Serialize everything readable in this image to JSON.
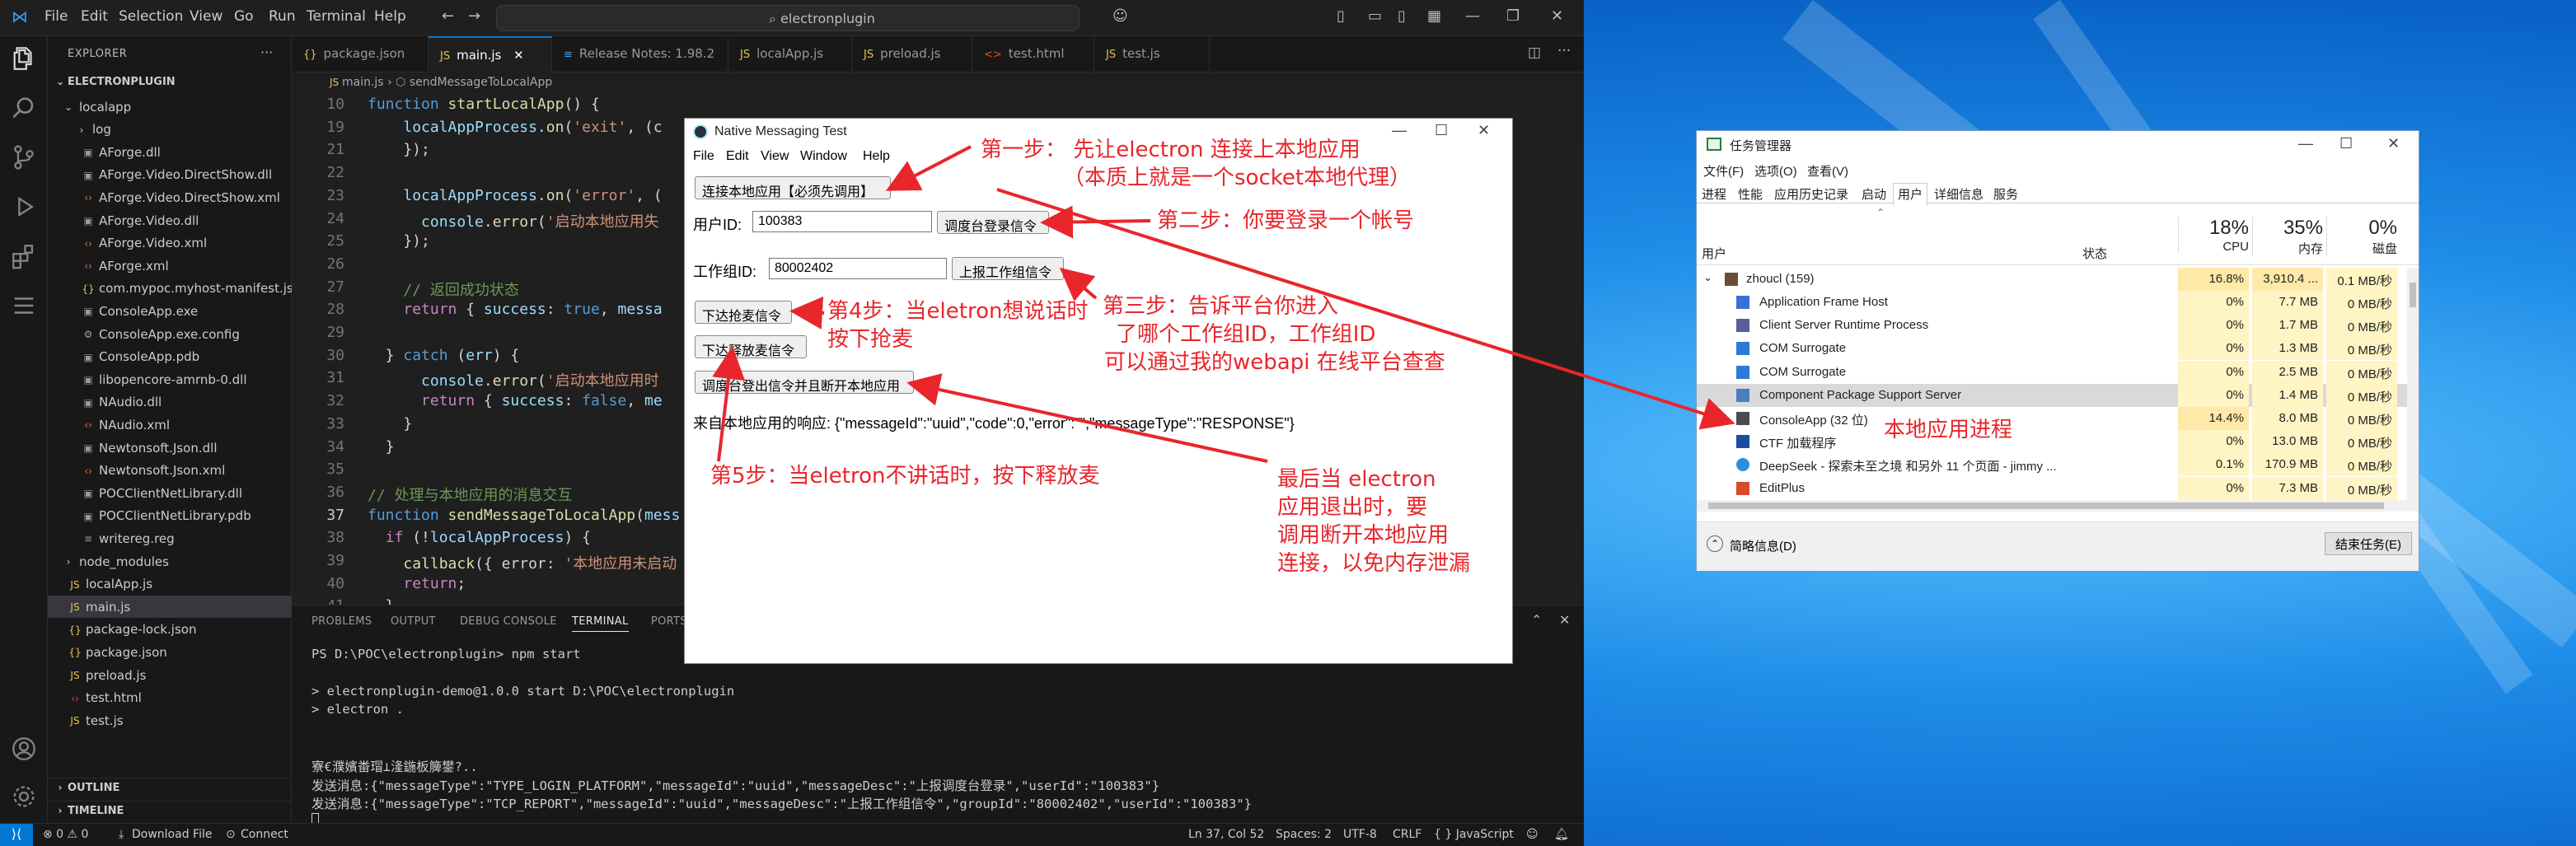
{
  "vscode": {
    "menu": [
      "File",
      "Edit",
      "Selection",
      "View",
      "Go",
      "Run",
      "Terminal",
      "Help"
    ],
    "search": "electronplugin",
    "explorer_title": "EXPLORER",
    "project": "ELECTRONPLUGIN",
    "tree": [
      {
        "name": "localapp",
        "type": "folder-open",
        "depth": 1
      },
      {
        "name": "log",
        "type": "folder",
        "depth": 2
      },
      {
        "name": "AForge.dll",
        "type": "dll",
        "depth": 2
      },
      {
        "name": "AForge.Video.DirectShow.dll",
        "type": "dll",
        "depth": 2
      },
      {
        "name": "AForge.Video.DirectShow.xml",
        "type": "xml",
        "depth": 2
      },
      {
        "name": "AForge.Video.dll",
        "type": "dll",
        "depth": 2
      },
      {
        "name": "AForge.Video.xml",
        "type": "xml",
        "depth": 2
      },
      {
        "name": "AForge.xml",
        "type": "xml",
        "depth": 2
      },
      {
        "name": "com.mypoc.myhost-manifest.js...",
        "type": "json",
        "depth": 2
      },
      {
        "name": "ConsoleApp.exe",
        "type": "dll",
        "depth": 2
      },
      {
        "name": "ConsoleApp.exe.config",
        "type": "config",
        "depth": 2
      },
      {
        "name": "ConsoleApp.pdb",
        "type": "dll",
        "depth": 2
      },
      {
        "name": "libopencore-amrnb-0.dll",
        "type": "dll",
        "depth": 2
      },
      {
        "name": "NAudio.dll",
        "type": "dll",
        "depth": 2
      },
      {
        "name": "NAudio.xml",
        "type": "xml",
        "depth": 2
      },
      {
        "name": "Newtonsoft.Json.dll",
        "type": "dll",
        "depth": 2
      },
      {
        "name": "Newtonsoft.Json.xml",
        "type": "xml",
        "depth": 2
      },
      {
        "name": "POCClientNetLibrary.dll",
        "type": "dll",
        "depth": 2
      },
      {
        "name": "POCClientNetLibrary.pdb",
        "type": "dll",
        "depth": 2
      },
      {
        "name": "writereg.reg",
        "type": "reg",
        "depth": 2
      },
      {
        "name": "node_modules",
        "type": "folder",
        "depth": 1
      },
      {
        "name": "localApp.js",
        "type": "js",
        "depth": 1
      },
      {
        "name": "main.js",
        "type": "js",
        "depth": 1,
        "selected": true
      },
      {
        "name": "package-lock.json",
        "type": "json",
        "depth": 1
      },
      {
        "name": "package.json",
        "type": "json",
        "depth": 1
      },
      {
        "name": "preload.js",
        "type": "js",
        "depth": 1
      },
      {
        "name": "test.html",
        "type": "html",
        "depth": 1
      },
      {
        "name": "test.js",
        "type": "js",
        "depth": 1
      }
    ],
    "outline": "OUTLINE",
    "timeline": "TIMELINE",
    "tabs": [
      {
        "label": "package.json",
        "icon": "{}"
      },
      {
        "label": "main.js",
        "icon": "JS",
        "active": true
      },
      {
        "label": "Release Notes: 1.98.2",
        "icon": "≡"
      },
      {
        "label": "localApp.js",
        "icon": "JS"
      },
      {
        "label": "preload.js",
        "icon": "JS"
      },
      {
        "label": "test.html",
        "icon": "<>"
      },
      {
        "label": "test.js",
        "icon": "JS"
      }
    ],
    "breadcrumb": [
      "main.js",
      "sendMessageToLocalApp"
    ],
    "code_lines": [
      {
        "n": "10",
        "text": "function startLocalApp() {"
      },
      {
        "n": "19",
        "text": "    localAppProcess.on('exit', (c"
      },
      {
        "n": "21",
        "text": "    });"
      },
      {
        "n": "22",
        "text": ""
      },
      {
        "n": "23",
        "text": "    localAppProcess.on('error', ("
      },
      {
        "n": "24",
        "text": "      console.error('启动本地应用失"
      },
      {
        "n": "25",
        "text": "    });"
      },
      {
        "n": "26",
        "text": ""
      },
      {
        "n": "27",
        "text": "    // 返回成功状态"
      },
      {
        "n": "28",
        "text": "    return { success: true, messa"
      },
      {
        "n": "29",
        "text": ""
      },
      {
        "n": "30",
        "text": "  } catch (err) {"
      },
      {
        "n": "31",
        "text": "      console.error('启动本地应用时"
      },
      {
        "n": "32",
        "text": "      return { success: false, me"
      },
      {
        "n": "33",
        "text": "    }"
      },
      {
        "n": "34",
        "text": "  }"
      },
      {
        "n": "35",
        "text": ""
      },
      {
        "n": "36",
        "text": "// 处理与本地应用的消息交互"
      },
      {
        "n": "37",
        "text": "function sendMessageToLocalApp(mess"
      },
      {
        "n": "38",
        "text": "  if (!localAppProcess) {"
      },
      {
        "n": "39",
        "text": "    callback({ error: '本地应用未启动"
      },
      {
        "n": "40",
        "text": "    return;"
      },
      {
        "n": "41",
        "text": "  }"
      }
    ],
    "panel_tabs": [
      "PROBLEMS",
      "OUTPUT",
      "DEBUG CONSOLE",
      "TERMINAL",
      "PORTS"
    ],
    "terminal": [
      "PS D:\\POC\\electronplugin> npm start",
      "",
      "> electronplugin-demo@1.0.0 start D:\\POC\\electronplugin",
      "> electron .",
      "",
      "",
      "寮€濮嬪畨瑁⊥湰鍦板簲鐢?..",
      "发送消息:{\"messageType\":\"TYPE_LOGIN_PLATFORM\",\"messageId\":\"uuid\",\"messageDesc\":\"上报调度台登录\",\"userId\":\"100383\"}",
      "发送消息:{\"messageType\":\"TCP_REPORT\",\"messageId\":\"uuid\",\"messageDesc\":\"上报工作组信令\",\"groupId\":\"80002402\",\"userId\":\"100383\"}"
    ],
    "status": {
      "problems": "⊗ 0 ⚠ 0",
      "download": "Download File",
      "connect": "Connect",
      "position": "Ln 37, Col 52",
      "spaces": "Spaces: 2",
      "encoding": "UTF-8",
      "eol": "CRLF",
      "language": "{ } JavaScript"
    }
  },
  "nm": {
    "title": "Native Messaging Test",
    "menu": [
      "File",
      "Edit",
      "View",
      "Window",
      "Help"
    ],
    "connect_btn": "连接本地应用【必须先调用】",
    "user_label": "用户ID:",
    "user_value": "100383",
    "login_btn": "调度台登录信令",
    "group_label": "工作组ID:",
    "group_value": "80002402",
    "report_btn": "上报工作组信令",
    "ptt_down_btn": "下达抢麦信令",
    "ptt_up_btn": "下达释放麦信令",
    "logout_btn": "调度台登出信令并且断开本地应用",
    "response": "来自本地应用的响应: {\"messageId\":\"uuid\",\"code\":0,\"error\":\"\",\"messageType\":\"RESPONSE\"}"
  },
  "annotations": {
    "step1_line1": "第一步：  先让electron 连接上本地应用",
    "step1_line2": "（本质上就是一个socket本地代理）",
    "step2": "第二步：你要登录一个帐号",
    "step3_line1": "第三步：告诉平台你进入",
    "step3_line2": "了哪个工作组ID，工作组ID",
    "step3_line3": "可以通过我的webapi 在线平台查查",
    "step4_line1": "第4步：当eletron想说话时",
    "step4_line2": "按下抢麦",
    "step5": "第5步：当eletron不讲话时，按下释放麦",
    "final_line1": "最后当 electron",
    "final_line2": "应用退出时，要",
    "final_line3": "调用断开本地应用",
    "final_line4": "连接，以免内存泄漏",
    "local_process": "本地应用进程"
  },
  "taskmgr": {
    "title": "任务管理器",
    "menu": [
      "文件(F)",
      "选项(O)",
      "查看(V)"
    ],
    "tabs": [
      "进程",
      "性能",
      "应用历史记录",
      "启动",
      "用户",
      "详细信息",
      "服务"
    ],
    "active_tab": "用户",
    "col_user": "用户",
    "col_status": "状态",
    "cpu_pct": "18%",
    "cpu_label": "CPU",
    "mem_pct": "35%",
    "mem_label": "内存",
    "disk_pct": "0%",
    "disk_label": "磁盘",
    "group_row": {
      "name": "zhoucl (159)",
      "cpu": "16.8%",
      "mem": "3,910.4 ...",
      "disk": "0.1 MB/秒"
    },
    "rows": [
      {
        "name": "Application Frame Host",
        "cpu": "0%",
        "mem": "7.7 MB",
        "disk": "0 MB/秒"
      },
      {
        "name": "Client Server Runtime Process",
        "cpu": "0%",
        "mem": "1.7 MB",
        "disk": "0 MB/秒"
      },
      {
        "name": "COM Surrogate",
        "cpu": "0%",
        "mem": "1.3 MB",
        "disk": "0 MB/秒"
      },
      {
        "name": "COM Surrogate",
        "cpu": "0%",
        "mem": "2.5 MB",
        "disk": "0 MB/秒"
      },
      {
        "name": "Component Package Support Server",
        "cpu": "0%",
        "mem": "1.4 MB",
        "disk": "0 MB/秒"
      },
      {
        "name": "ConsoleApp (32 位)",
        "cpu": "14.4%",
        "mem": "8.0 MB",
        "disk": "0 MB/秒"
      },
      {
        "name": "CTF 加载程序",
        "cpu": "0%",
        "mem": "13.0 MB",
        "disk": "0 MB/秒"
      },
      {
        "name": "DeepSeek - 探索未至之境 和另外 11 个页面 - jimmy ...",
        "cpu": "0.1%",
        "mem": "170.9 MB",
        "disk": "0 MB/秒"
      },
      {
        "name": "EditPlus",
        "cpu": "0%",
        "mem": "7.3 MB",
        "disk": "0 MB/秒"
      }
    ],
    "brief": "简略信息(D)",
    "end_task": "结束任务(E)"
  }
}
